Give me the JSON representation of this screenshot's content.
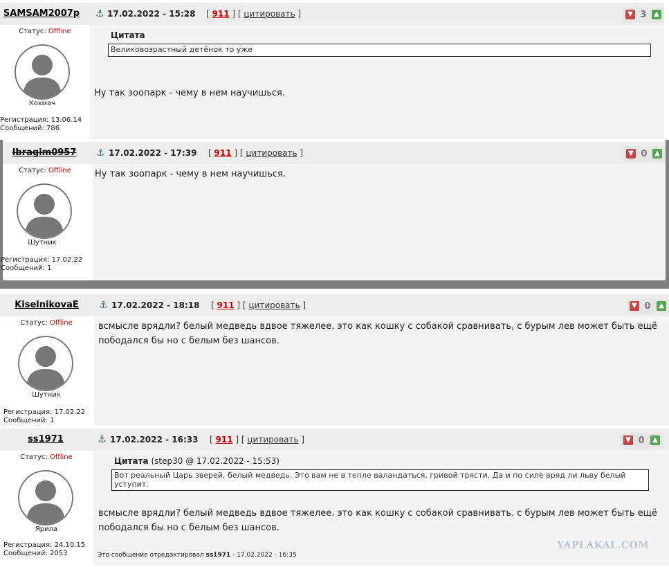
{
  "posts": [
    {
      "username": "SAMSAM2007p",
      "date": "17.02.2022 - 15:28",
      "topic_num": "911",
      "cite_label": "цитировать",
      "rating": "3",
      "status_label": "Статус: ",
      "status_value": "Offline",
      "rank": "Хохмач",
      "registration": "Регистрация: 13.06.14",
      "messages": "Сообщений: 786",
      "quote_title": "Цитата",
      "quote_text": "Великовозрастный детёнок то уже",
      "message": "Ну так зоопарк - чему в нем научишься."
    },
    {
      "username": "Ibragim0957",
      "date": "17.02.2022 - 17:39",
      "topic_num": "911",
      "cite_label": "цитировать",
      "rating": "0",
      "status_label": "Статус: ",
      "status_value": "Offline",
      "rank": "Шутник",
      "registration": "Регистрация: 17.02.22",
      "messages": "Сообщений: 1",
      "message": "Ну так зоопарк - чему в нем научишься."
    },
    {
      "username": "KiselnikovaE",
      "date": "17.02.2022 - 18:18",
      "topic_num": "911",
      "cite_label": "цитировать",
      "rating": "0",
      "status_label": "Статус: ",
      "status_value": "Offline",
      "rank": "Шутник",
      "registration": "Регистрация: 17.02.22",
      "messages": "Сообщений: 1",
      "message_line1": "всмысле врядли? белый медведь вдвое тяжелее. это как кошку с собакой сравнивать, с бурым лев может быть ещё",
      "message_line2": "пободался бы но с белым без шансов."
    },
    {
      "username": "ss1971",
      "date": "17.02.2022 - 16:33",
      "topic_num": "911",
      "cite_label": "цитировать",
      "rating": "0",
      "status_label": "Статус: ",
      "status_value": "Offline",
      "rank": "Ярила",
      "registration": "Регистрация: 24.10.15",
      "messages": "Сообщений: 2053",
      "quote_title": "Цитата",
      "quote_meta": " (step30 @ 17.02.2022 - 15:53)",
      "quote_line1": "Вот реальный Царь зверей, белый медведь. Это вам не в тепле валандаться, гривой трясти. Да и по силе вряд ли льву белый",
      "quote_line2": "уступит.",
      "message_line1": "всмысле врядли? белый медведь вдвое тяжелее. это как кошку с собакой сравнивать. с бурым лев может быть ещё",
      "message_line2": "пободался бы но с белым без шансов.",
      "edited_prefix": "Это сообщение отредактировал ",
      "edited_user": "ss1971",
      "edited_suffix": " - 17.02.2022 - 16:35"
    }
  ],
  "watermark": "YAPLAKAL.COM",
  "colors": {
    "offline": "#d40000",
    "topic_num": "#cc0000",
    "rate_down": "#c54848",
    "rate_up": "#55a555"
  }
}
